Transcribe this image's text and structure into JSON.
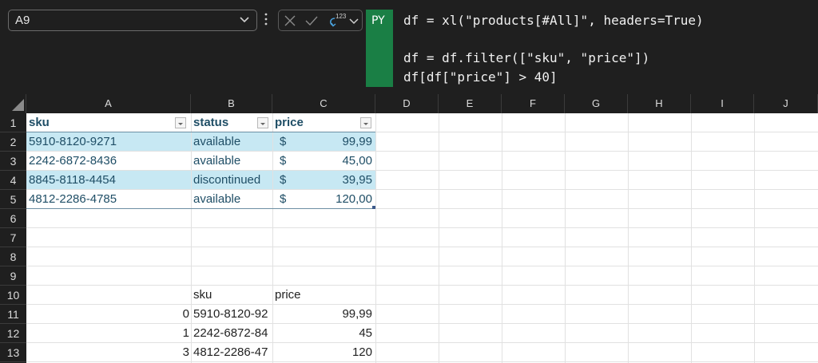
{
  "name_box": {
    "value": "A9"
  },
  "formula_bar": {
    "badge": "PY",
    "code": [
      "df = xl(\"products[#All]\", headers=True)",
      "",
      "df = df.filter([\"sku\", \"price\"])",
      "df[df[\"price\"] > 40]"
    ],
    "python_output_label": "123"
  },
  "columns": [
    "A",
    "B",
    "C",
    "D",
    "E",
    "F",
    "G",
    "H",
    "I",
    "J"
  ],
  "rows": [
    "1",
    "2",
    "3",
    "4",
    "5",
    "6",
    "7",
    "8",
    "9",
    "10",
    "11",
    "12",
    "13"
  ],
  "table": {
    "headers": {
      "sku": "sku",
      "status": "status",
      "price": "price"
    },
    "rows": [
      {
        "sku": "5910-8120-9271",
        "status": "available",
        "currency": "$",
        "price": "99,99"
      },
      {
        "sku": "2242-6872-8436",
        "status": "available",
        "currency": "$",
        "price": "45,00"
      },
      {
        "sku": "8845-8118-4454",
        "status": "discontinued",
        "currency": "$",
        "price": "39,95"
      },
      {
        "sku": "4812-2286-4785",
        "status": "available",
        "currency": "$",
        "price": "120,00"
      }
    ]
  },
  "output": {
    "headers": {
      "sku": "sku",
      "price": "price"
    },
    "rows": [
      {
        "index": "0",
        "sku": "5910-8120-92",
        "price": "99,99"
      },
      {
        "index": "1",
        "sku": "2242-6872-84",
        "price": "45"
      },
      {
        "index": "3",
        "sku": "4812-2286-47",
        "price": "120"
      }
    ]
  },
  "colors": {
    "band": "#c7e8f3",
    "py_green": "#1a7f45",
    "header_bg": "#1f1f1f"
  }
}
